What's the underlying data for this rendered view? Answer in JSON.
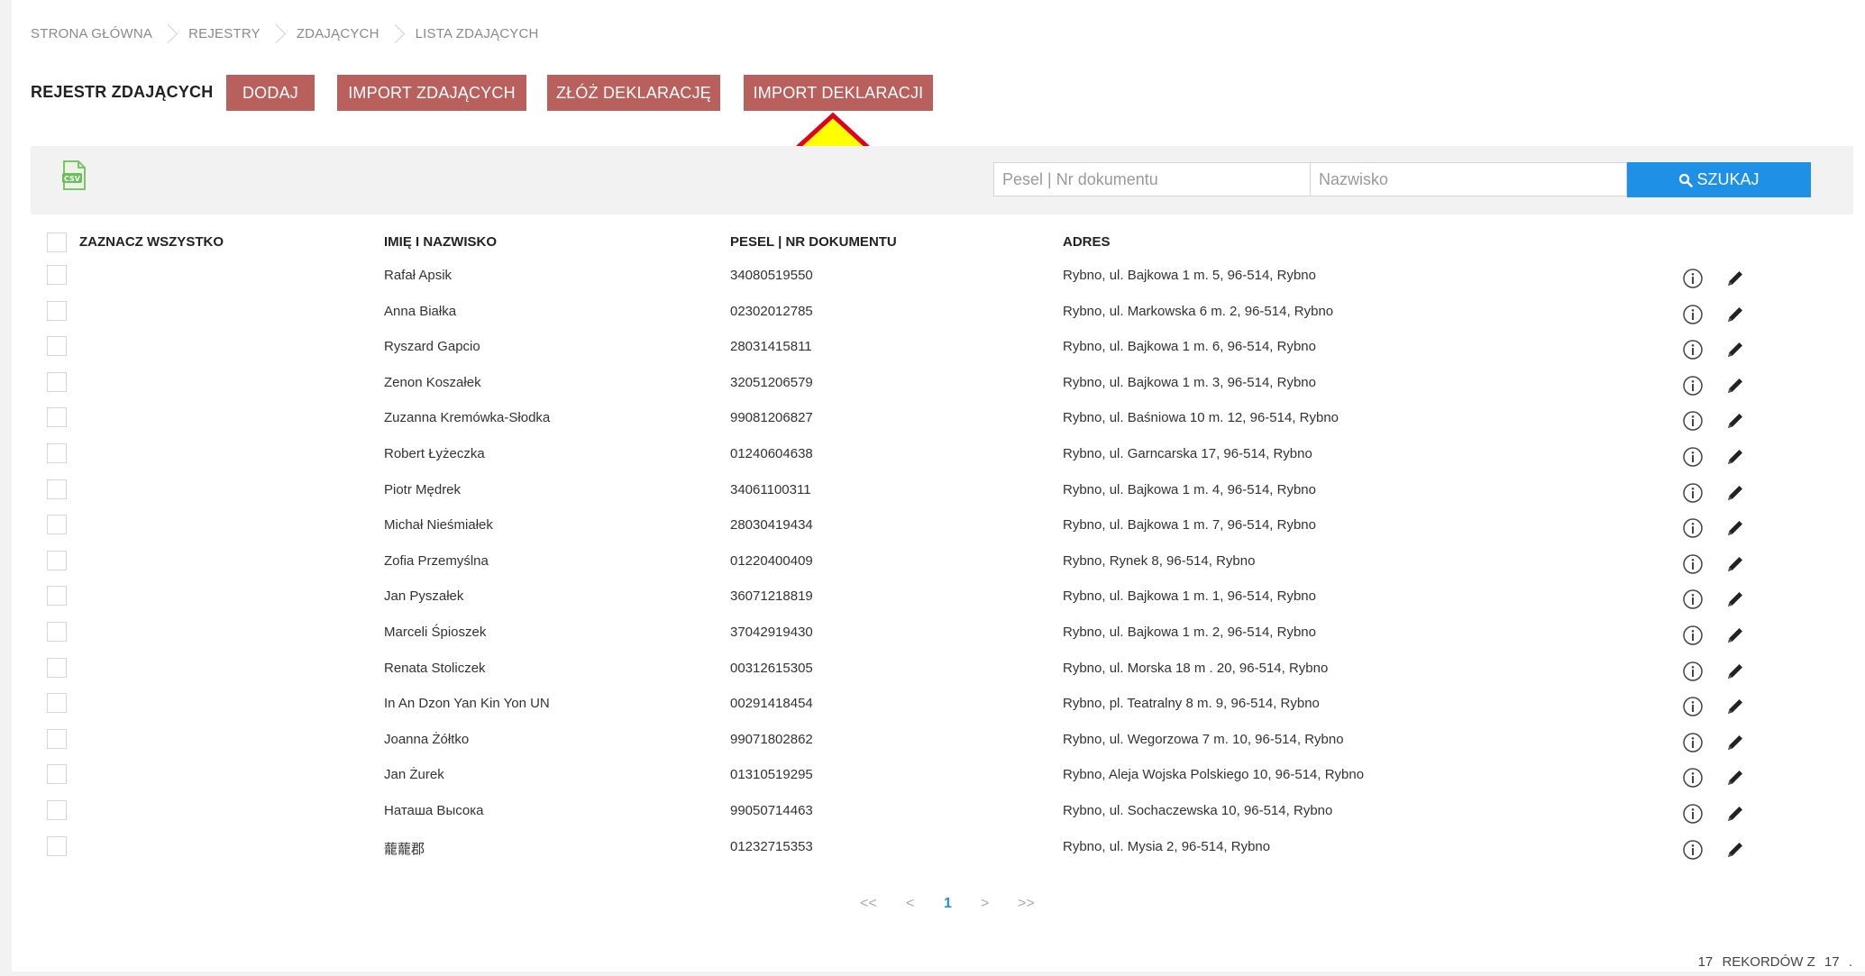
{
  "breadcrumb": [
    "STRONA GŁÓWNA",
    "REJESTRY",
    "ZDAJĄCYCH",
    "LISTA ZDAJĄCYCH"
  ],
  "header": {
    "title": "REJESTR ZDAJĄCYCH",
    "buttons": {
      "add": "DODAJ",
      "import_candidates": "IMPORT ZDAJĄCYCH",
      "submit_declaration": "ZŁÓŻ DEKLARACJĘ",
      "import_declarations": "IMPORT DEKLARACJI"
    }
  },
  "annotation": {
    "arrow_color": "#ffff00",
    "arrow_outline": "#e0001b"
  },
  "toolbar": {
    "pesel_placeholder": "Pesel | Nr dokumentu",
    "surname_placeholder": "Nazwisko",
    "search_label": "SZUKAJ"
  },
  "table": {
    "select_all": "ZAZNACZ WSZYSTKO",
    "columns": {
      "name": "IMIĘ I NAZWISKO",
      "pesel": "PESEL | NR DOKUMENTU",
      "address": "ADRES"
    },
    "rows": [
      {
        "name": "Rafał Apsik",
        "pesel": "34080519550",
        "address": "Rybno, ul. Bajkowa 1 m. 5, 96-514, Rybno"
      },
      {
        "name": "Anna Białka",
        "pesel": "02302012785",
        "address": "Rybno, ul. Markowska 6 m. 2, 96-514, Rybno"
      },
      {
        "name": "Ryszard Gapcio",
        "pesel": "28031415811",
        "address": "Rybno, ul. Bajkowa 1 m. 6, 96-514, Rybno"
      },
      {
        "name": "Zenon Koszałek",
        "pesel": "32051206579",
        "address": "Rybno, ul. Bajkowa 1 m. 3, 96-514, Rybno"
      },
      {
        "name": "Zuzanna Kremówka-Słodka",
        "pesel": "99081206827",
        "address": "Rybno, ul. Baśniowa 10 m. 12, 96-514, Rybno"
      },
      {
        "name": "Robert Łyżeczka",
        "pesel": "01240604638",
        "address": "Rybno, ul. Garncarska 17, 96-514, Rybno"
      },
      {
        "name": "Piotr Mędrek",
        "pesel": "34061100311",
        "address": "Rybno, ul. Bajkowa 1 m. 4, 96-514, Rybno"
      },
      {
        "name": "Michał Nieśmiałek",
        "pesel": "28030419434",
        "address": "Rybno, ul. Bajkowa 1 m. 7, 96-514, Rybno"
      },
      {
        "name": "Zofia Przemyślna",
        "pesel": "01220400409",
        "address": "Rybno, Rynek 8, 96-514, Rybno"
      },
      {
        "name": "Jan Pyszałek",
        "pesel": "36071218819",
        "address": "Rybno, ul. Bajkowa 1 m. 1, 96-514, Rybno"
      },
      {
        "name": "Marceli Śpioszek",
        "pesel": "37042919430",
        "address": "Rybno, ul. Bajkowa 1 m. 2, 96-514, Rybno"
      },
      {
        "name": "Renata Stoliczek",
        "pesel": "00312615305",
        "address": "Rybno, ul. Morska 18 m . 20, 96-514, Rybno"
      },
      {
        "name": "In An Dzon Yan Kin Yon UN",
        "pesel": "00291418454",
        "address": "Rybno, pl. Teatralny 8 m. 9, 96-514, Rybno"
      },
      {
        "name": "Joanna Żółtko",
        "pesel": "99071802862",
        "address": "Rybno, ul. Wegorzowa 7 m. 10, 96-514, Rybno"
      },
      {
        "name": "Jan Żurek",
        "pesel": "01310519295",
        "address": "Rybno, Aleja Wojska Polskiego 10, 96-514, Rybno"
      },
      {
        "name": "Наташа Высока",
        "pesel": "99050714463",
        "address": "Rybno, ul. Sochaczewska 10, 96-514, Rybno"
      },
      {
        "name": "蘢蘢郡",
        "pesel": "01232715353",
        "address": "Rybno, ul. Mysia 2, 96-514, Rybno"
      }
    ]
  },
  "pagination": {
    "first": "<<",
    "prev": "<",
    "current": "1",
    "next": ">",
    "last": ">>"
  },
  "footer": {
    "shown": "17",
    "label": "REKORDÓW Z",
    "total": "17",
    "tail": "."
  }
}
